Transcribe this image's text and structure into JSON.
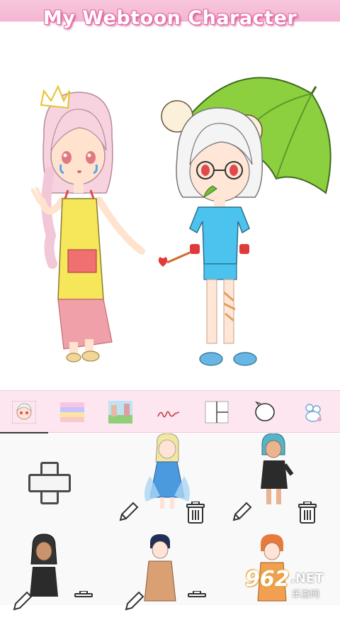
{
  "header": {
    "title": "My Webtoon Character"
  },
  "tabs": [
    {
      "id": "face",
      "icon": "face-tab-icon",
      "active": true
    },
    {
      "id": "colors",
      "icon": "color-palette-tab-icon",
      "active": false
    },
    {
      "id": "background",
      "icon": "background-tab-icon",
      "active": false
    },
    {
      "id": "text",
      "icon": "signature-tab-icon",
      "active": false
    },
    {
      "id": "frame",
      "icon": "frame-tab-icon",
      "active": false
    },
    {
      "id": "bubble",
      "icon": "speech-bubble-tab-icon",
      "active": false
    },
    {
      "id": "stickers",
      "icon": "sticker-tab-icon",
      "active": false
    }
  ],
  "grid": {
    "add_icon": "plus-icon",
    "edit_icon": "pencil-icon",
    "delete_icon": "trash-icon"
  },
  "watermark": {
    "number": "962",
    "suffix": ".NET",
    "sub": "乐游网"
  },
  "colors": {
    "banner_pink": "#f3b6d4",
    "title_outline": "#e96aa8",
    "tabbar_bg": "#fde6ef",
    "umbrella_green": "#8ccf3f",
    "outfit_blue": "#4cc3ef",
    "apron_yellow": "#f6e65a"
  }
}
